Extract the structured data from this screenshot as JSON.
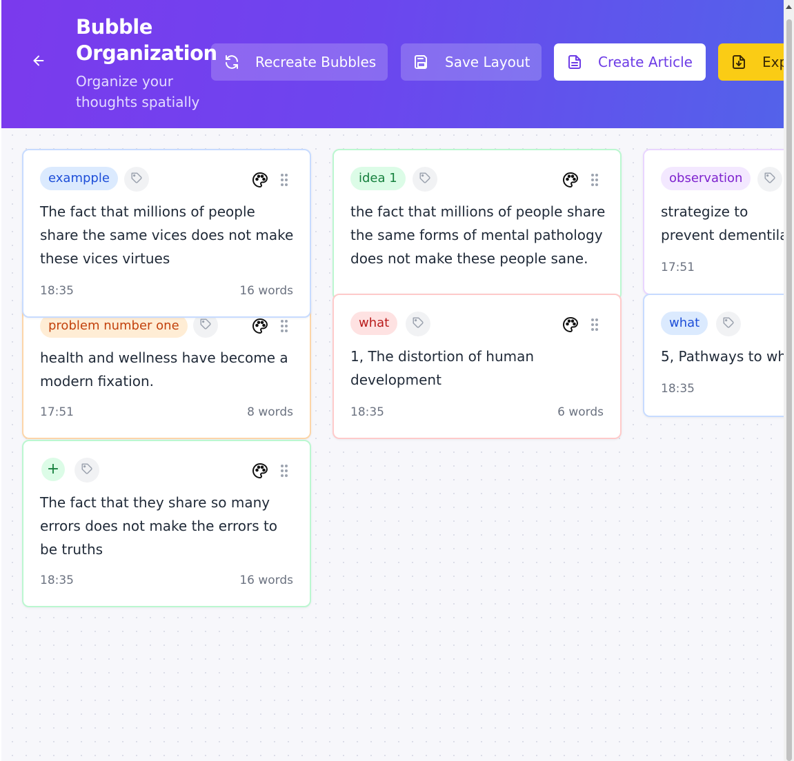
{
  "header": {
    "title": "Bubble Organization",
    "subtitle": "Organize your thoughts spatially",
    "buttons": {
      "recreate": "Recreate Bubbles",
      "save": "Save Layout",
      "create_article": "Create Article",
      "export": "Export"
    },
    "icons": {
      "back": "arrow-left-icon",
      "recreate": "refresh-icon",
      "save": "save-icon",
      "create_article": "document-icon",
      "export": "file-download-icon"
    }
  },
  "colors": {
    "header_gradient_start": "#7b3aed",
    "header_gradient_end": "#5362ea",
    "accent_purple": "#6d3ce6",
    "export_yellow": "#facc15"
  },
  "cards": [
    {
      "tag": "exampple",
      "text": "The fact that millions of people share the same vices does not make these vices virtues",
      "time": "18:35",
      "words": "16 words",
      "color": "blue"
    },
    {
      "tag": "problem number one",
      "text": "health and wellness have become a modern fixation.",
      "time": "17:51",
      "words": "8 words",
      "color": "orange"
    },
    {
      "tag": "+",
      "text": "The fact that they share so many errors does not make the errors to be truths",
      "time": "18:35",
      "words": "16 words",
      "color": "green"
    },
    {
      "tag": "idea 1",
      "text": "the fact that millions of people share the same forms of mental pathology does not make these people sane.",
      "time": "",
      "words": "",
      "color": "green"
    },
    {
      "tag": "what",
      "text": "1, The distortion of human development",
      "time": "18:35",
      "words": "6 words",
      "color": "red"
    },
    {
      "tag": "observation",
      "text": "strategize to prevent dementila",
      "time": "17:51",
      "words": "",
      "color": "purple"
    },
    {
      "tag": "what",
      "text": "5, Pathways to wh",
      "time": "18:35",
      "words": "",
      "color": "blue"
    }
  ]
}
